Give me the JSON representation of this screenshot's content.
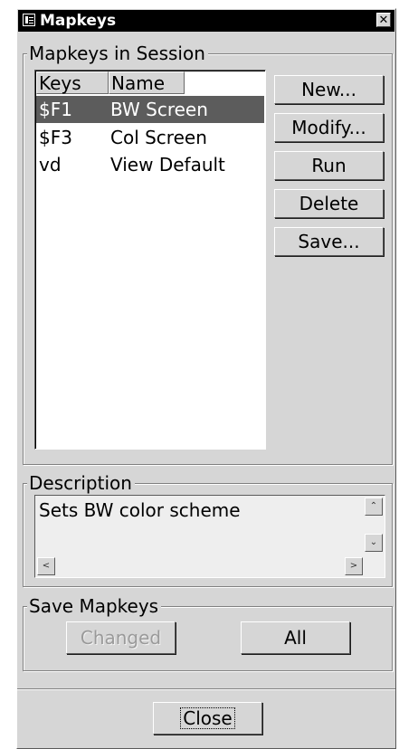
{
  "window": {
    "title": "Mapkeys",
    "close_glyph": "✕",
    "icon": "window-menu-icon"
  },
  "session_group": {
    "legend": "Mapkeys in Session",
    "columns": [
      "Keys",
      "Name"
    ],
    "rows": [
      {
        "keys": "$F1",
        "name": "BW Screen",
        "selected": true
      },
      {
        "keys": "$F3",
        "name": "Col Screen",
        "selected": false
      },
      {
        "keys": "vd",
        "name": "View Default",
        "selected": false
      }
    ],
    "buttons": {
      "new": "New...",
      "modify": "Modify...",
      "run": "Run",
      "delete": "Delete",
      "save": "Save..."
    }
  },
  "description_group": {
    "legend": "Description",
    "text": "Sets BW color scheme",
    "scroll_up_glyph": "⌃",
    "scroll_down_glyph": "⌄",
    "scroll_left_glyph": "<",
    "scroll_right_glyph": ">"
  },
  "save_group": {
    "legend": "Save Mapkeys",
    "changed_label": "Changed",
    "changed_disabled": true,
    "all_label": "All"
  },
  "footer": {
    "close_label": "Close"
  },
  "colors": {
    "dialog_bg": "#d6d6d6",
    "titlebar_bg": "#000000",
    "selection_bg": "#5c5c5c",
    "list_bg": "#ffffff"
  }
}
